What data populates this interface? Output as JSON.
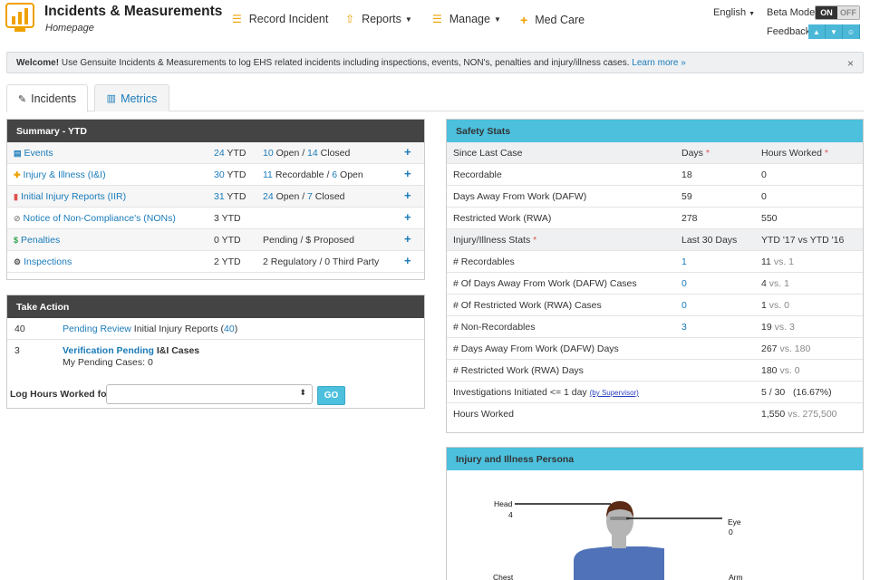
{
  "header": {
    "title": "Incidents & Measurements",
    "subtitle": "Homepage",
    "nav": [
      {
        "label": "Record Incident",
        "icon": "sliders-icon"
      },
      {
        "label": "Reports",
        "icon": "upload-icon",
        "caret": true
      },
      {
        "label": "Manage",
        "icon": "sliders-icon",
        "caret": true
      },
      {
        "label": "Med Care",
        "icon": "plus-icon"
      }
    ],
    "language": "English",
    "beta_label": "Beta Mode:",
    "beta_on": "ON",
    "beta_off": "OFF",
    "feedback_label": "Feedback:"
  },
  "welcome": {
    "bold": "Welcome!",
    "text": " Use Gensuite Incidents & Measurements to log EHS related incidents including inspections, events, NON's, penalties and injury/illness cases. ",
    "link": "Learn more »",
    "close": "×"
  },
  "tabs": [
    {
      "label": "Incidents",
      "active": true
    },
    {
      "label": "Metrics",
      "active": false
    }
  ],
  "summary": {
    "title": "Summary - YTD",
    "rows": [
      {
        "name": "Events",
        "ytd": "24",
        "ytd_link": true,
        "d1": "10",
        "d1_text": " Open / ",
        "d2": "14",
        "d2_text": " Closed",
        "d_link": true
      },
      {
        "name": "Injury & Illness (I&I)",
        "ytd": "30",
        "ytd_link": true,
        "d1": "11",
        "d1_text": " Recordable / ",
        "d2": "6",
        "d2_text": " Open",
        "d_link": true
      },
      {
        "name": "Initial Injury Reports (IIR)",
        "ytd": "31",
        "ytd_link": true,
        "d1": "24",
        "d1_text": " Open / ",
        "d2": "7",
        "d2_text": " Closed",
        "d_link": true
      },
      {
        "name": "Notice of Non-Compliance's (NONs)",
        "ytd": "3",
        "ytd_link": false,
        "d1": "",
        "d1_text": "",
        "d2": "",
        "d2_text": "",
        "d_link": false
      },
      {
        "name": "Penalties",
        "ytd": "0",
        "ytd_link": false,
        "d1": "Pending / $ Proposed",
        "d1_text": "",
        "d2": "",
        "d2_text": "",
        "d_link": false
      },
      {
        "name": "Inspections",
        "ytd": "2",
        "ytd_link": false,
        "d1": "2 Regulatory / 0 Third Party",
        "d1_text": "",
        "d2": "",
        "d2_text": "",
        "d_link": false
      }
    ],
    "ytd_suffix": " YTD",
    "add": "+"
  },
  "take_action": {
    "title": "Take Action",
    "row1_count": "40",
    "row1_link": "Pending Review",
    "row1_text": " Initial Injury Reports (",
    "row1_num": "40",
    "row1_close": ")",
    "row2_count": "3",
    "row2_link": "Verification Pending",
    "row2_text": " I&I Cases",
    "row2_sub": "My Pending Cases: 0",
    "log_label": "Log Hours Worked for:",
    "go": "GO"
  },
  "safety": {
    "title": "Safety Stats",
    "head1": [
      "Since Last Case",
      "Days",
      "Hours Worked"
    ],
    "rows1": [
      [
        "Recordable",
        "18",
        "0"
      ],
      [
        "Days Away From Work (DAFW)",
        "59",
        "0"
      ],
      [
        "Restricted Work (RWA)",
        "278",
        "550"
      ]
    ],
    "head2": [
      "Injury/Illness Stats",
      "Last 30 Days",
      "YTD '17 vs YTD '16"
    ],
    "rows2": [
      {
        "label": "# Recordables",
        "last30": "1",
        "ytd": "11",
        "prev": "1"
      },
      {
        "label": "# Of Days Away From Work (DAFW) Cases",
        "last30": "0",
        "ytd": "4",
        "prev": "1"
      },
      {
        "label": "# Of Restricted Work (RWA) Cases",
        "last30": "0",
        "ytd": "1",
        "prev": "0"
      },
      {
        "label": "# Non-Recordables",
        "last30": "3",
        "ytd": "19",
        "prev": "3"
      },
      {
        "label": "# Days Away From Work (DAFW) Days",
        "last30": "",
        "ytd": "267",
        "prev": "180"
      },
      {
        "label": "# Restricted Work (RWA) Days",
        "last30": "",
        "ytd": "180",
        "prev": "0"
      }
    ],
    "inv_label": "Investigations Initiated <= 1 day ",
    "inv_link": "(by Supervisor)",
    "inv_value": "5 / 30   (16.67%)",
    "hours_label": "Hours Worked",
    "hours_ytd": "1,550",
    "hours_prev": "275,500",
    "vs": " vs. ",
    "star": " *"
  },
  "persona": {
    "title": "Injury and Illness Persona",
    "head_label": "Head",
    "head_value": "4",
    "eye_label": "Eye",
    "eye_value": "0",
    "chest_label": "Chest",
    "arm_label": "Arm",
    "skin_color": "#b5b5b5",
    "hair_color": "#5a2a14",
    "shirt_color": "#4f72b8"
  }
}
